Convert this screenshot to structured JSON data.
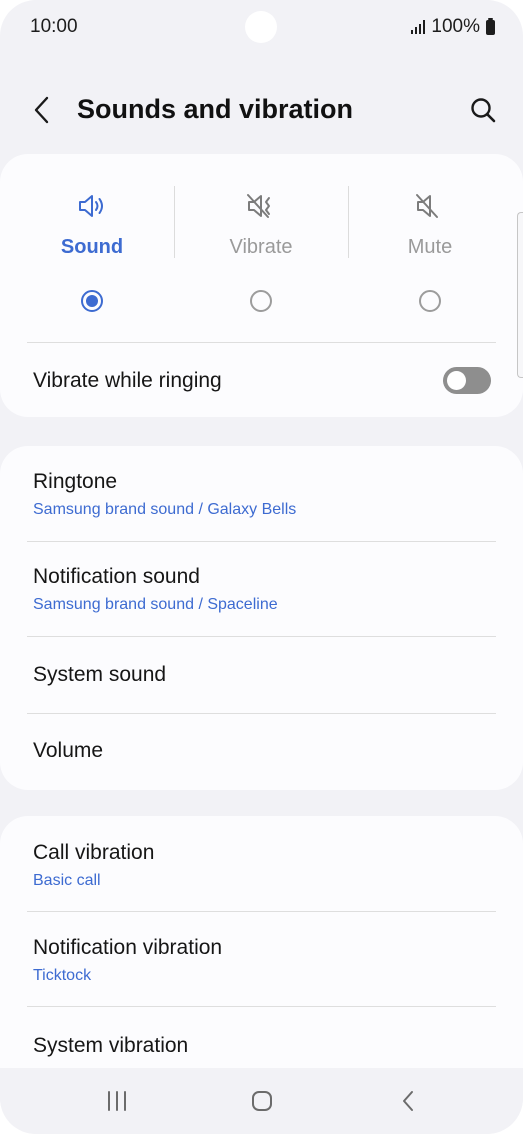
{
  "status_bar": {
    "time": "10:00",
    "battery": "100%"
  },
  "header": {
    "title": "Sounds and vibration",
    "back_icon": "chevron-left-icon",
    "search_icon": "search-icon"
  },
  "modes": {
    "selected": "Sound",
    "items": [
      {
        "label": "Sound",
        "icon": "speaker-icon"
      },
      {
        "label": "Vibrate",
        "icon": "vibrate-icon"
      },
      {
        "label": "Mute",
        "icon": "mute-icon"
      }
    ]
  },
  "vibrate_while_ringing": {
    "label": "Vibrate while ringing",
    "enabled": false
  },
  "sound_settings": [
    {
      "title": "Ringtone",
      "subtitle": "Samsung brand sound / Galaxy Bells"
    },
    {
      "title": "Notification sound",
      "subtitle": "Samsung brand sound / Spaceline"
    },
    {
      "title": "System sound"
    },
    {
      "title": "Volume"
    }
  ],
  "vibration_settings": [
    {
      "title": "Call vibration",
      "subtitle": "Basic call"
    },
    {
      "title": "Notification vibration",
      "subtitle": "Ticktock"
    },
    {
      "title": "System vibration"
    }
  ],
  "colors": {
    "accent": "#3d6bd1",
    "background": "#f2f2f6",
    "card": "#fcfcfe"
  },
  "nav_bar": {
    "icons": [
      "recents-icon",
      "home-icon",
      "back-icon"
    ]
  }
}
